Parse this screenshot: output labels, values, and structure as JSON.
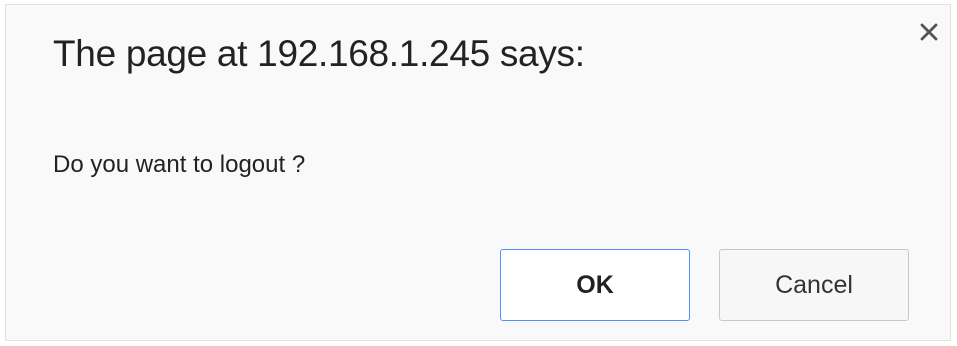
{
  "dialog": {
    "title": "The page at 192.168.1.245 says:",
    "message": "Do you want to logout ?",
    "close_icon": "close-icon",
    "buttons": {
      "ok_label": "OK",
      "cancel_label": "Cancel"
    },
    "colors": {
      "ok_border": "#4d90fe",
      "background": "#f9f9f9"
    }
  }
}
